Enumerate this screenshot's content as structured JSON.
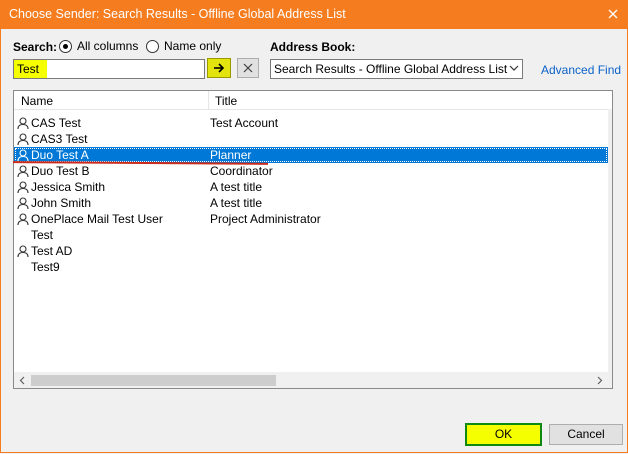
{
  "window": {
    "title": "Choose Sender: Search Results - Offline Global Address List",
    "close_glyph": "✕"
  },
  "search": {
    "label": "Search:",
    "mode_all": "All columns",
    "mode_name": "Name only",
    "selected_mode": "All columns",
    "value": "Test",
    "go_glyph": "➔",
    "clear_glyph": "✕"
  },
  "address_book": {
    "label": "Address Book:",
    "selected": "Search Results - Offline Global Address List"
  },
  "advanced_find": "Advanced Find",
  "list": {
    "columns": [
      "Name",
      "Title"
    ],
    "rows": [
      {
        "name": "CAS Test",
        "title": "Test Account",
        "icon": "user-icon",
        "selected": false
      },
      {
        "name": "CAS3 Test",
        "title": "",
        "icon": "user-icon",
        "selected": false
      },
      {
        "name": "Duo Test A",
        "title": "Planner",
        "icon": "user-icon",
        "selected": true
      },
      {
        "name": "Duo Test B",
        "title": "Coordinator",
        "icon": "user-icon",
        "selected": false
      },
      {
        "name": "Jessica Smith",
        "title": "A test title",
        "icon": "user-icon",
        "selected": false
      },
      {
        "name": "John Smith",
        "title": "A test title",
        "icon": "user-icon",
        "selected": false
      },
      {
        "name": "OnePlace Mail Test User",
        "title": "Project Administrator",
        "icon": "user-icon",
        "selected": false
      },
      {
        "name": "Test",
        "title": "",
        "icon": "",
        "selected": false
      },
      {
        "name": "Test AD",
        "title": "",
        "icon": "user-icon",
        "selected": false
      },
      {
        "name": "Test9",
        "title": "",
        "icon": "",
        "selected": false
      }
    ]
  },
  "buttons": {
    "ok": "OK",
    "cancel": "Cancel"
  },
  "colors": {
    "titlebar": "#f57c1f",
    "selection": "#0078d7",
    "highlight": "#f5ff00",
    "annotation": "#cc2a1a"
  }
}
